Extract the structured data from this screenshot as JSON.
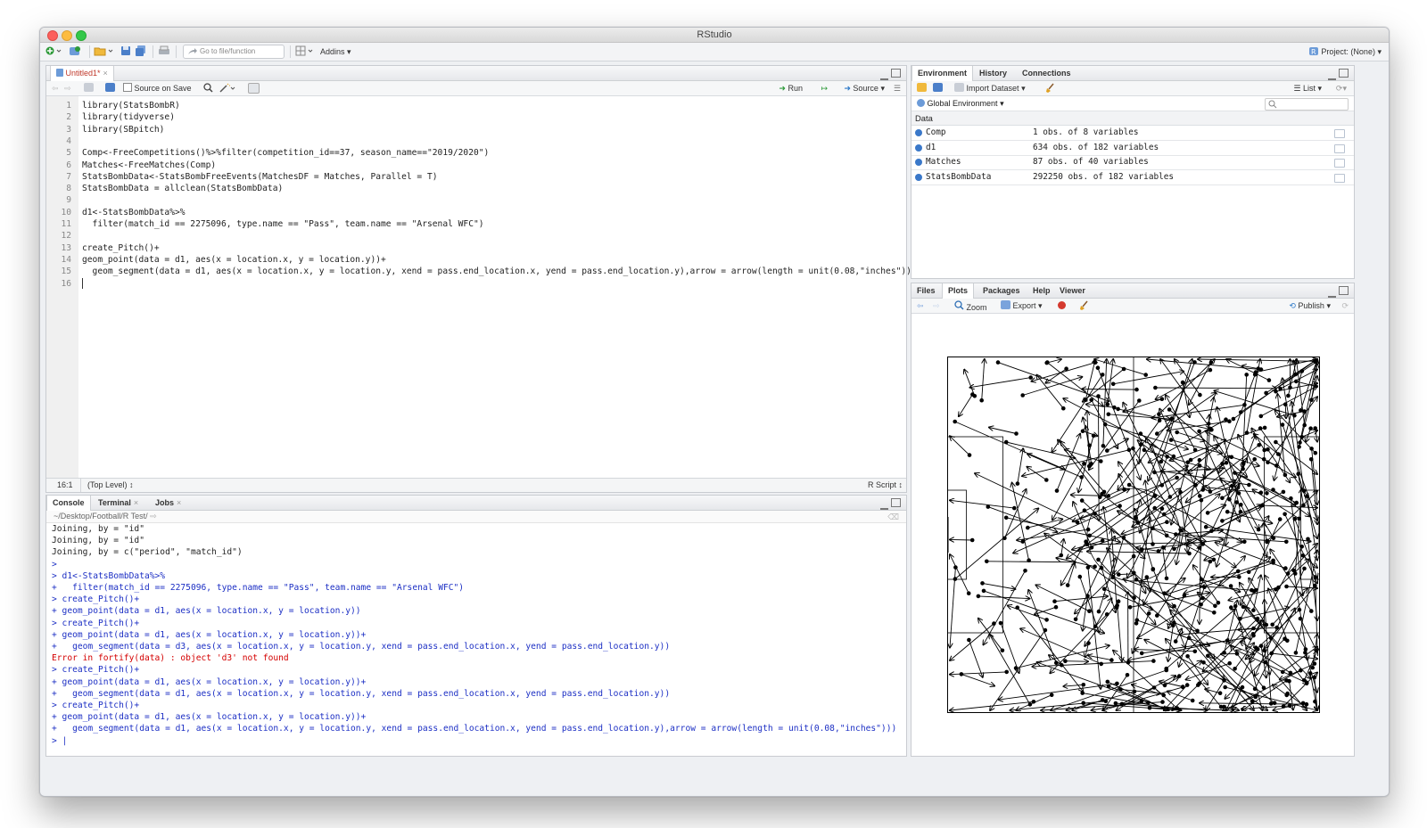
{
  "window": {
    "title": "RStudio"
  },
  "main_toolbar": {
    "goto_placeholder": "Go to file/function",
    "addins_label": "Addins",
    "project_label": "Project: (None)"
  },
  "editor": {
    "tab_label": "Untitled1*",
    "source_on_save_label": "Source on Save",
    "run_label": "Run",
    "source_label": "Source",
    "lines": [
      "library(StatsBombR)",
      "library(tidyverse)",
      "library(SBpitch)",
      "",
      "Comp<-FreeCompetitions()%>%filter(competition_id==37, season_name==\"2019/2020\")",
      "Matches<-FreeMatches(Comp)",
      "StatsBombData<-StatsBombFreeEvents(MatchesDF = Matches, Parallel = T)",
      "StatsBombData = allclean(StatsBombData)",
      "",
      "d1<-StatsBombData%>%",
      "  filter(match_id == 2275096, type.name == \"Pass\", team.name == \"Arsenal WFC\")",
      "",
      "create_Pitch()+",
      "geom_point(data = d1, aes(x = location.x, y = location.y))+",
      "  geom_segment(data = d1, aes(x = location.x, y = location.y, xend = pass.end_location.x, yend = pass.end_location.y),arrow = arrow(length = unit(0.08,\"inches\")))",
      ""
    ],
    "cursor_position": "16:1",
    "scope": "(Top Level) ↕",
    "file_type": "R Script ↕"
  },
  "console": {
    "tabs": [
      "Console",
      "Terminal",
      "Jobs"
    ],
    "path": "~/Desktop/Football/R Test/",
    "lines": [
      {
        "t": "out",
        "text": "Joining, by = \"id\""
      },
      {
        "t": "out",
        "text": "Joining, by = \"id\""
      },
      {
        "t": "out",
        "text": "Joining, by = c(\"period\", \"match_id\")"
      },
      {
        "t": "in",
        "text": ">"
      },
      {
        "t": "in",
        "text": "> d1<-StatsBombData%>%"
      },
      {
        "t": "in",
        "text": "+   filter(match_id == 2275096, type.name == \"Pass\", team.name == \"Arsenal WFC\")"
      },
      {
        "t": "in",
        "text": "> create_Pitch()+"
      },
      {
        "t": "in",
        "text": "+ geom_point(data = d1, aes(x = location.x, y = location.y))"
      },
      {
        "t": "in",
        "text": "> create_Pitch()+"
      },
      {
        "t": "in",
        "text": "+ geom_point(data = d1, aes(x = location.x, y = location.y))+"
      },
      {
        "t": "in",
        "text": "+   geom_segment(data = d3, aes(x = location.x, y = location.y, xend = pass.end_location.x, yend = pass.end_location.y))"
      },
      {
        "t": "err",
        "text": "Error in fortify(data) : object 'd3' not found"
      },
      {
        "t": "in",
        "text": "> create_Pitch()+"
      },
      {
        "t": "in",
        "text": "+ geom_point(data = d1, aes(x = location.x, y = location.y))+"
      },
      {
        "t": "in",
        "text": "+   geom_segment(data = d1, aes(x = location.x, y = location.y, xend = pass.end_location.x, yend = pass.end_location.y))"
      },
      {
        "t": "in",
        "text": "> create_Pitch()+"
      },
      {
        "t": "in",
        "text": "+ geom_point(data = d1, aes(x = location.x, y = location.y))+"
      },
      {
        "t": "in",
        "text": "+   geom_segment(data = d1, aes(x = location.x, y = location.y, xend = pass.end_location.x, yend = pass.end_location.y),arrow = arrow(length = unit(0.08,\"inches\")))"
      },
      {
        "t": "in",
        "text": "> |"
      }
    ]
  },
  "environment": {
    "tabs": [
      "Environment",
      "History",
      "Connections"
    ],
    "import_label": "Import Dataset",
    "list_label": "List",
    "scope_label": "Global Environment",
    "section": "Data",
    "rows": [
      {
        "name": "Comp",
        "value": "1 obs. of 8 variables"
      },
      {
        "name": "d1",
        "value": "634 obs. of 182 variables"
      },
      {
        "name": "Matches",
        "value": "87 obs. of 40 variables"
      },
      {
        "name": "StatsBombData",
        "value": "292250 obs. of 182 variables"
      }
    ]
  },
  "plots": {
    "tabs": [
      "Files",
      "Plots",
      "Packages",
      "Help",
      "Viewer"
    ],
    "zoom_label": "Zoom",
    "export_label": "Export",
    "publish_label": "Publish"
  },
  "colors": {
    "accent": "#3a78c9",
    "console_input": "#1c2fc4",
    "console_error": "#d40000"
  }
}
